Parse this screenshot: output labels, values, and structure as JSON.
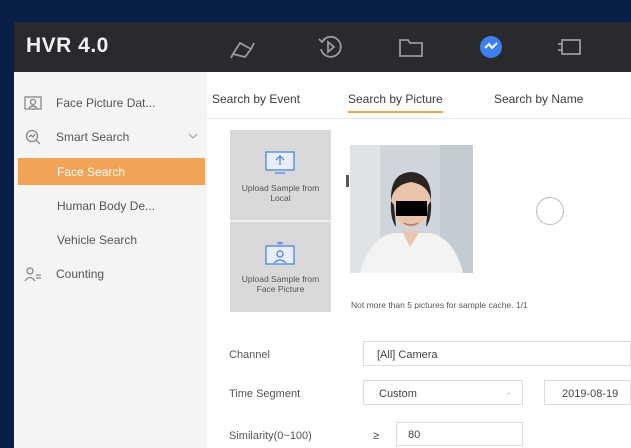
{
  "app": {
    "title": "HVR 4.0"
  },
  "toolbar": {
    "icons": [
      "camera-icon",
      "playback-icon",
      "folder-icon",
      "smart-search-icon",
      "config-icon"
    ],
    "active_color": "#3d7ff0"
  },
  "sidebar": {
    "items": [
      {
        "label": "Face Picture Dat...",
        "icon": "face-picture-icon"
      },
      {
        "label": "Smart Search",
        "icon": "smart-search-icon"
      },
      {
        "label": "Face Search",
        "active": true
      },
      {
        "label": "Human Body De..."
      },
      {
        "label": "Vehicle Search"
      },
      {
        "label": "Counting",
        "icon": "counting-icon"
      }
    ],
    "accent": "#f2a456"
  },
  "tabs": [
    {
      "label": "Search by Event"
    },
    {
      "label": "Search by Picture",
      "active": true
    },
    {
      "label": "Search by Name"
    }
  ],
  "upload": {
    "local_label": "Upload Sample from Local",
    "face_label": "Upload Sample from Face Picture"
  },
  "note": "Not more than 5 pictures for sample cache. 1/1",
  "form": {
    "channel_label": "Channel",
    "channel_value": "[All] Camera",
    "time_label": "Time Segment",
    "time_value": "Custom",
    "time_caret": "-",
    "date_value": "2019-08-19",
    "similarity_label": "Similarity(0~100)",
    "similarity_op": "≥",
    "similarity_value": "80"
  }
}
